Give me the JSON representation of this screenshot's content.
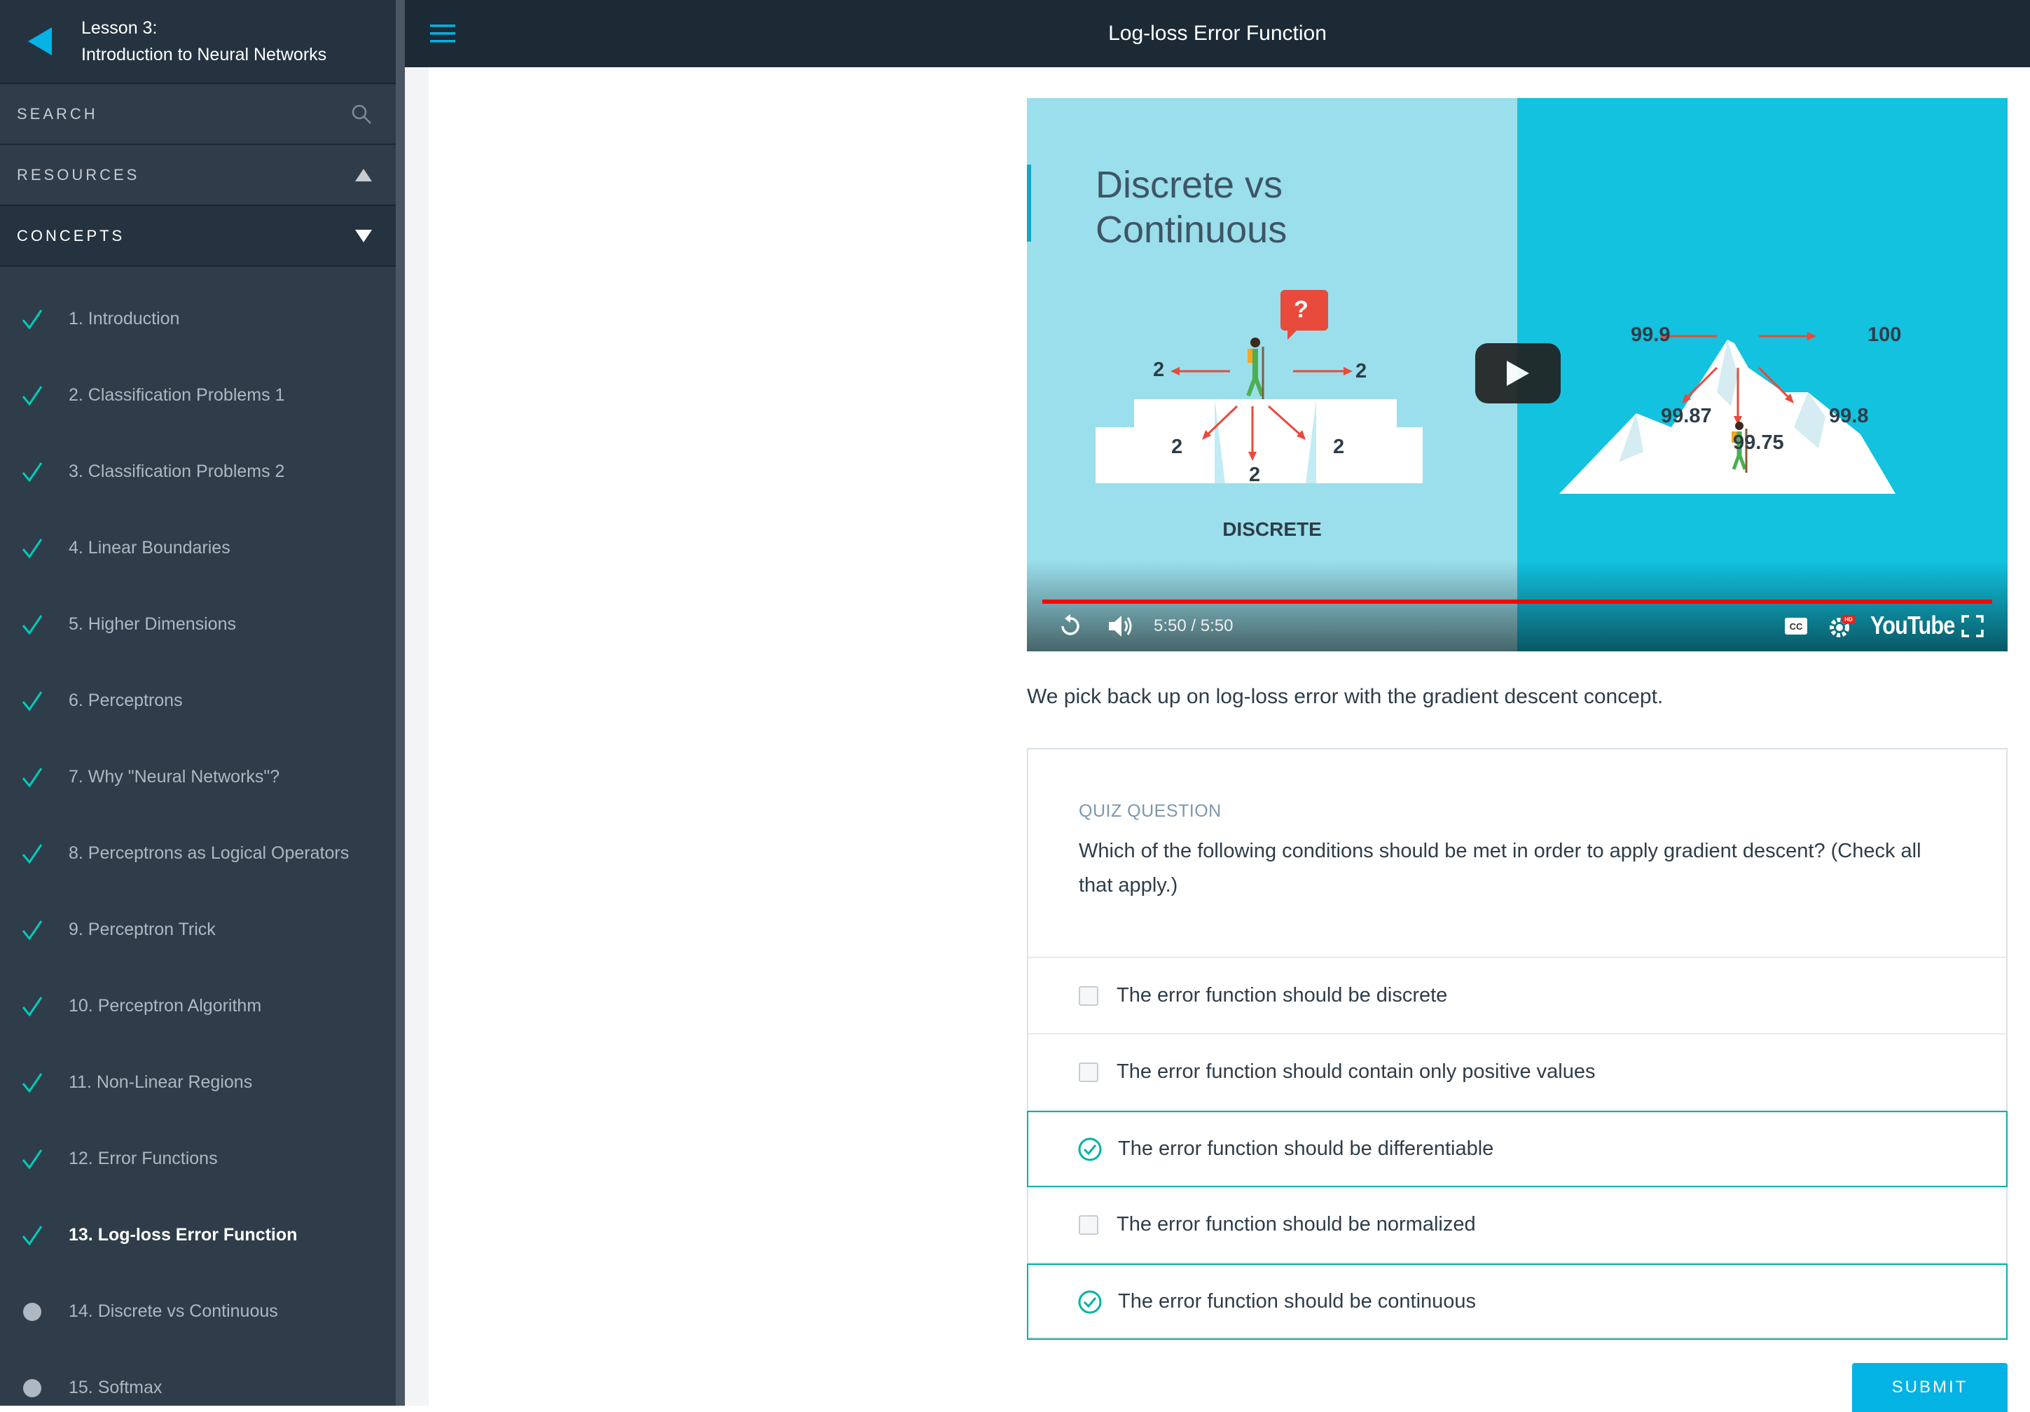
{
  "sidebar": {
    "lesson_number": "Lesson 3:",
    "lesson_title": "Introduction to Neural Networks",
    "search_label": "SEARCH",
    "resources_label": "RESOURCES",
    "concepts_label": "CONCEPTS",
    "concepts": [
      {
        "label": "1. Introduction",
        "status": "done"
      },
      {
        "label": "2. Classification Problems 1",
        "status": "done"
      },
      {
        "label": "3. Classification Problems 2",
        "status": "done"
      },
      {
        "label": "4. Linear Boundaries",
        "status": "done"
      },
      {
        "label": "5. Higher Dimensions",
        "status": "done"
      },
      {
        "label": "6. Perceptrons",
        "status": "done"
      },
      {
        "label": "7. Why \"Neural Networks\"?",
        "status": "done"
      },
      {
        "label": "8. Perceptrons as Logical Operators",
        "status": "done"
      },
      {
        "label": "9. Perceptron Trick",
        "status": "done"
      },
      {
        "label": "10. Perceptron Algorithm",
        "status": "done"
      },
      {
        "label": "11. Non-Linear Regions",
        "status": "done"
      },
      {
        "label": "12. Error Functions",
        "status": "done"
      },
      {
        "label": "13. Log-loss Error Function",
        "status": "current"
      },
      {
        "label": "14. Discrete vs Continuous",
        "status": "todo"
      },
      {
        "label": "15. Softmax",
        "status": "todo"
      }
    ]
  },
  "header": {
    "title": "Log-loss Error Function"
  },
  "video": {
    "title_line1": "Discrete vs",
    "title_line2": "Continuous",
    "discrete_label": "DISCRETE",
    "question_mark": "?",
    "discrete_values": {
      "left": "2",
      "right": "2",
      "down_left": "2",
      "down": "2",
      "down_right": "2"
    },
    "continuous_values": {
      "top_left": "99.9",
      "top_right": "100",
      "mid_left": "99.87",
      "mid_right": "99.8",
      "center": "99.75"
    },
    "time": "5:50 / 5:50",
    "progress_fraction": 1.0,
    "brand": "YouTube"
  },
  "intro_text": "We pick back up on log-loss error with the gradient descent concept.",
  "quiz": {
    "label": "QUIZ QUESTION",
    "question": "Which of the following conditions should be met in order to apply gradient descent? (Check all that apply.)",
    "options": [
      {
        "label": "The error function should be discrete",
        "checked": false
      },
      {
        "label": "The error function should contain only positive values",
        "checked": false
      },
      {
        "label": "The error function should be differentiable",
        "checked": true
      },
      {
        "label": "The error function should be normalized",
        "checked": false
      },
      {
        "label": "The error function should be continuous",
        "checked": true
      }
    ],
    "submit_label": "SUBMIT"
  },
  "colors": {
    "accent": "#02b3e4",
    "check_teal": "#02ccba",
    "correct_green": "#02b3a4",
    "sidebar_bg": "#2e3d49"
  }
}
